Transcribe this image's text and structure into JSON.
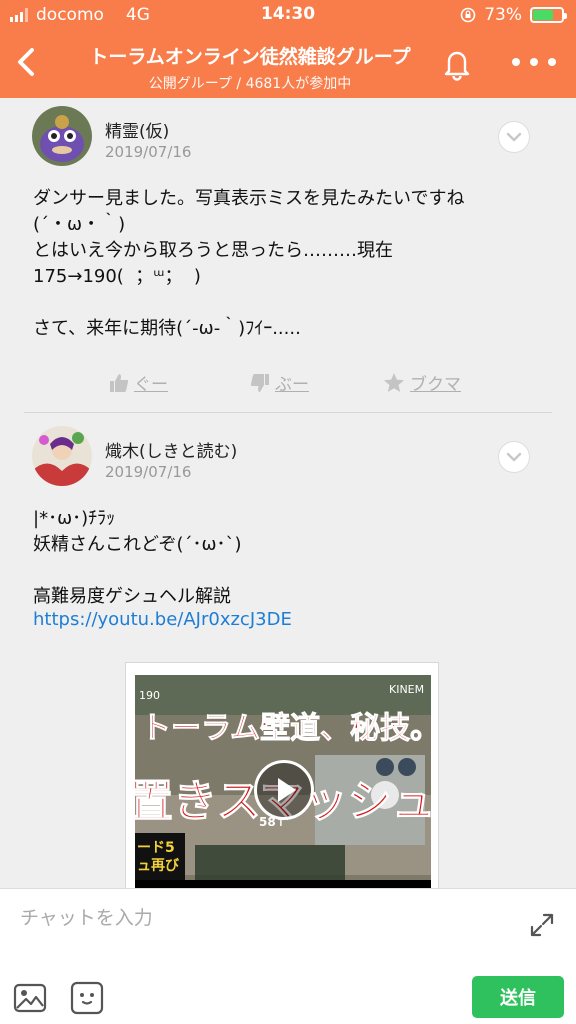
{
  "status_bar": {
    "carrier": "docomo",
    "network": "4G",
    "time": "14:30",
    "battery": "73%",
    "battery_level": 0.73
  },
  "header": {
    "title": "トーラムオンライン徒然雑談グループ",
    "subtitle": "公開グループ / 4681人が参加中",
    "brand_color": "#f97d4b"
  },
  "posts": [
    {
      "author": "精霊(仮)",
      "date": "2019/07/16",
      "body": "ダンサー見ました。写真表示ミスを見たみたいですね\n(´・ω・｀)\nとはいえ今から取ろうと思ったら………現在\n175→190(  ；ᵚ；  )\n\nさて、来年に期待(´-ω-｀)ﾌｲｰ.....",
      "actions": [
        {
          "label": "ぐー",
          "icon": "thumbs-up-icon"
        },
        {
          "label": "ぶー",
          "icon": "thumbs-down-icon"
        },
        {
          "label": "ブクマ",
          "icon": "star-icon"
        }
      ]
    },
    {
      "author": "熾木(しきと読む)",
      "date": "2019/07/16",
      "body": "|*･ω･)ﾁﾗｯ\n妖精さんこれどぞ(´･ω･`)\n\n高難易度ゲシュヘル解説",
      "link": "https://youtu.be/AJr0xzcJ3DE",
      "video_overlay_text": [
        "トーラム壁道、秘技。",
        "置きスマッシュ",
        "ード5",
        "ュ再び",
        "KINEM",
        "190",
        "58↑"
      ]
    }
  ],
  "composer": {
    "placeholder": "チャットを入力",
    "send_label": "送信",
    "send_color": "#2ec15d"
  }
}
